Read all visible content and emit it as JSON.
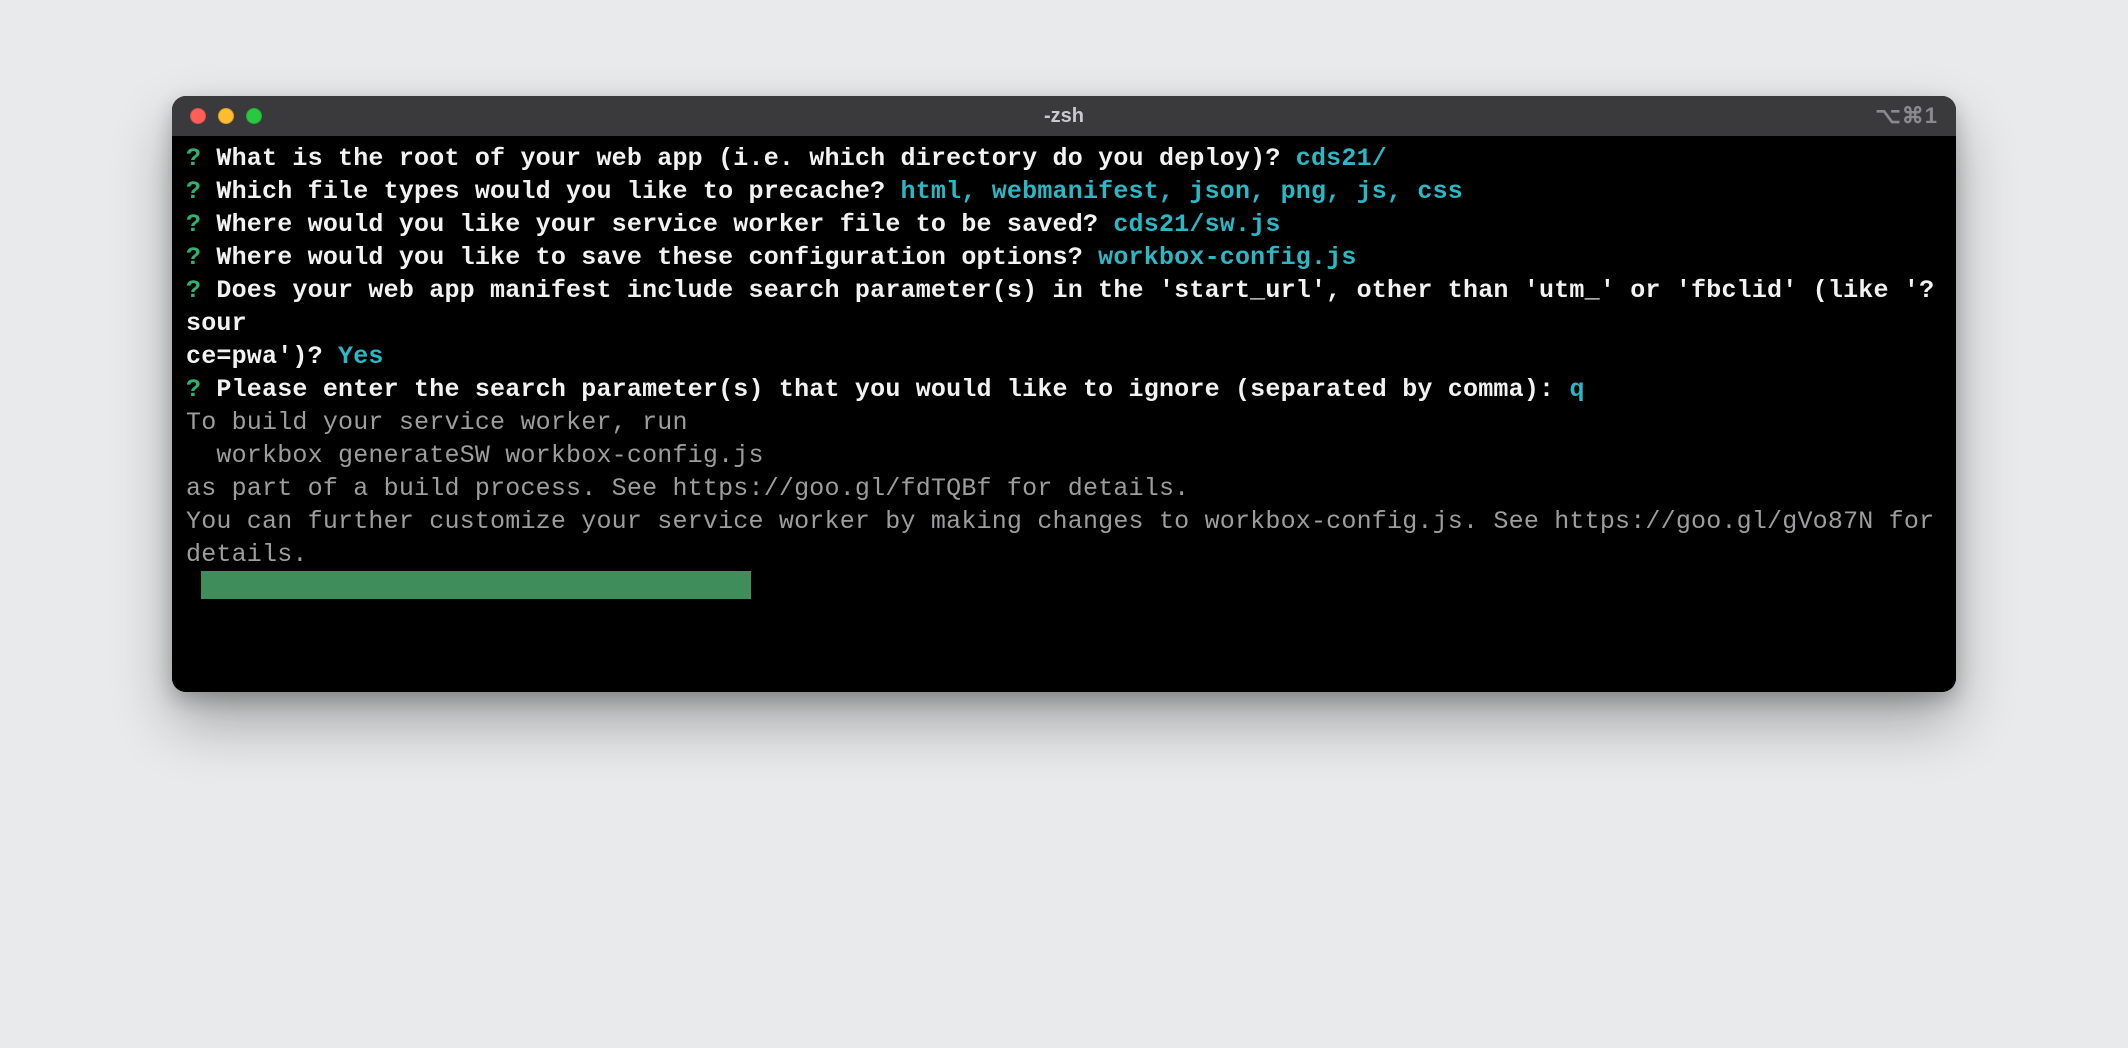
{
  "window": {
    "title": "-zsh",
    "shortcut": "⌥⌘1"
  },
  "colors": {
    "prompt_green": "#2fb170",
    "answer_cyan": "#2bb7c4",
    "text_white": "#f2f2f2",
    "text_grey": "#9d9d9f",
    "cursor_bg": "#3f8d5a"
  },
  "prompts": [
    {
      "q": "What is the root of your web app (i.e. which directory do you deploy)? ",
      "a": "cds21/"
    },
    {
      "q": "Which file types would you like to precache? ",
      "a": "html, webmanifest, json, png, js, css"
    },
    {
      "q": "Where would you like your service worker file to be saved? ",
      "a": "cds21/sw.js"
    },
    {
      "q": "Where would you like to save these configuration options? ",
      "a": "workbox-config.js"
    },
    {
      "q": "Does your web app manifest include search parameter(s) in the 'start_url', other than 'utm_' or 'fbclid' (like '?sour\nce=pwa')? ",
      "a": "Yes"
    },
    {
      "q": "Please enter the search parameter(s) that you would like to ignore (separated by comma): ",
      "a": "q"
    }
  ],
  "footer": [
    "To build your service worker, run",
    "",
    "  workbox generateSW workbox-config.js",
    "",
    "as part of a build process. See https://goo.gl/fdTQBf for details.",
    "You can further customize your service worker by making changes to workbox-config.js. See https://goo.gl/gVo87N for details."
  ],
  "prompt_marker": "?"
}
